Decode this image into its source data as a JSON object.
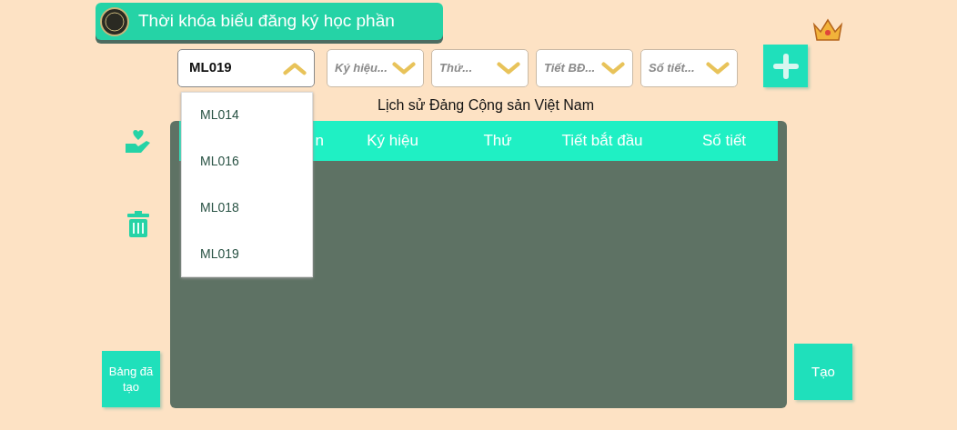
{
  "title": "Thời khóa biểu đăng ký học phần",
  "filters": [
    {
      "kind": "value",
      "text": "ML019",
      "expanded": true
    },
    {
      "kind": "placeholder",
      "text": "Ký hiệu...",
      "expanded": false
    },
    {
      "kind": "placeholder",
      "text": "Thứ...",
      "expanded": false
    },
    {
      "kind": "placeholder",
      "text": "Tiết BĐ...",
      "expanded": false
    },
    {
      "kind": "placeholder",
      "text": "Số tiết...",
      "expanded": false
    }
  ],
  "dropdown_options": [
    "ML014",
    "ML016",
    "ML018",
    "ML019"
  ],
  "course_name": "Lịch sử Đảng Cộng sản Việt Nam",
  "table": {
    "columns": [
      "n",
      "Ký hiệu",
      "Thứ",
      "Tiết bắt đầu",
      "Số tiết"
    ]
  },
  "buttons": {
    "created_tables": "Bảng đã tạo",
    "create": "Tạo"
  }
}
